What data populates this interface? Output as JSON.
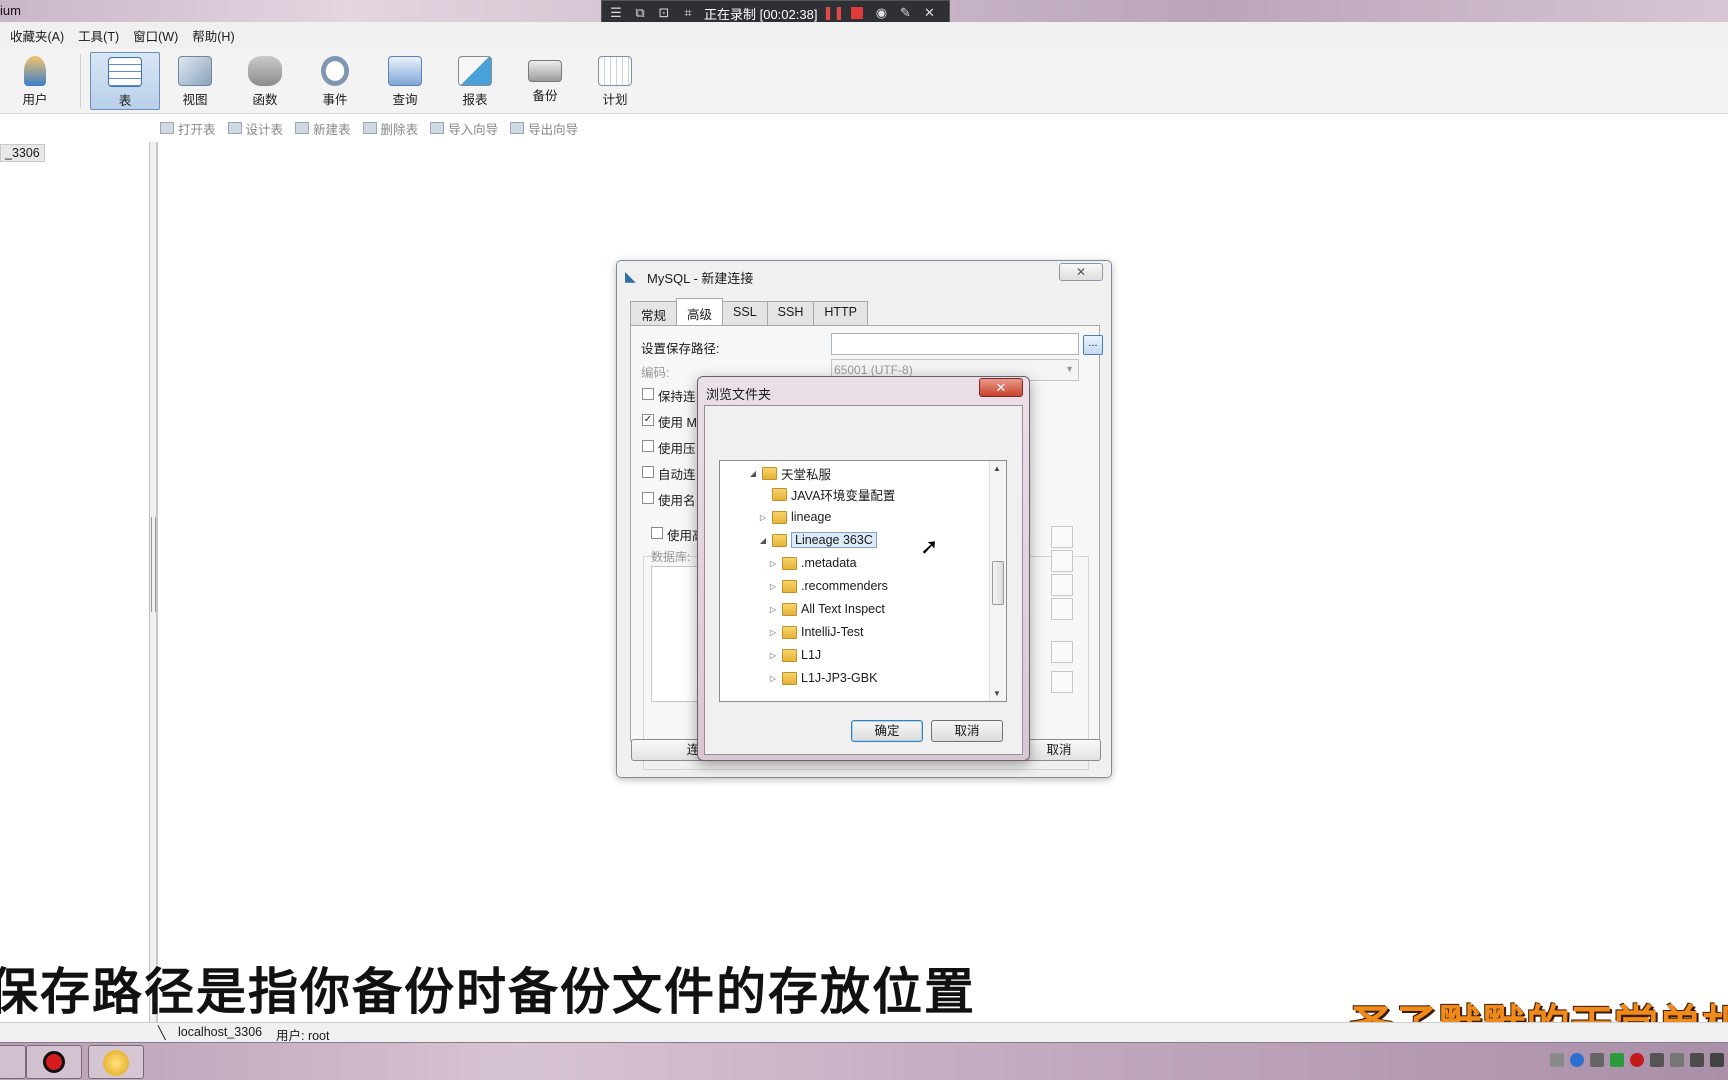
{
  "app_title": "ium",
  "recorder": {
    "status": "正在录制 [00:02:38]"
  },
  "menu": [
    "收藏夹(A)",
    "工具(T)",
    "窗口(W)",
    "帮助(H)"
  ],
  "toolbar": {
    "items": [
      {
        "label": "用户",
        "icon": "user-icon"
      },
      {
        "label": "表",
        "icon": "table-icon"
      },
      {
        "label": "视图",
        "icon": "view-icon"
      },
      {
        "label": "函数",
        "icon": "function-icon"
      },
      {
        "label": "事件",
        "icon": "event-icon"
      },
      {
        "label": "查询",
        "icon": "query-icon"
      },
      {
        "label": "报表",
        "icon": "report-icon"
      },
      {
        "label": "备份",
        "icon": "backup-icon"
      },
      {
        "label": "计划",
        "icon": "schedule-icon"
      }
    ],
    "active": "表"
  },
  "subtoolbar": [
    "打开表",
    "设计表",
    "新建表",
    "删除表",
    "导入向导",
    "导出向导"
  ],
  "left_panel": {
    "connection": "_3306"
  },
  "status_bar": {
    "connection": "localhost_3306",
    "user": "用户: root"
  },
  "mysql_dialog": {
    "title": "MySQL - 新建连接",
    "tabs": [
      "常规",
      "高级",
      "SSL",
      "SSH",
      "HTTP"
    ],
    "selected_tab": "高级",
    "save_path_label": "设置保存路径:",
    "browse_button": "...",
    "encoding_label": "编码:",
    "encoding_value": "65001 (UTF-8)",
    "checkboxes": [
      {
        "label": "保持连",
        "checked": false
      },
      {
        "label": "使用 M",
        "checked": true
      },
      {
        "label": "使用压",
        "checked": false
      },
      {
        "label": "自动连",
        "checked": false
      },
      {
        "label": "使用名",
        "checked": false
      }
    ],
    "advanced_checkbox": "使用高",
    "database_label": "数据库:",
    "connect_button": "连",
    "cancel_button": "取消"
  },
  "browse_dialog": {
    "title": "浏览文件夹",
    "tree": [
      {
        "label": "天堂私服",
        "depth": 0,
        "expander": "expanded"
      },
      {
        "label": "JAVA环境变量配置",
        "depth": 1,
        "expander": "none"
      },
      {
        "label": "lineage",
        "depth": 1,
        "expander": "collapsed"
      },
      {
        "label": "Lineage 363C",
        "depth": 1,
        "expander": "expanded",
        "selected": true
      },
      {
        "label": ".metadata",
        "depth": 2,
        "expander": "collapsed"
      },
      {
        "label": ".recommenders",
        "depth": 2,
        "expander": "collapsed"
      },
      {
        "label": "All Text Inspect",
        "depth": 2,
        "expander": "collapsed"
      },
      {
        "label": "IntelliJ-Test",
        "depth": 2,
        "expander": "collapsed"
      },
      {
        "label": "L1J",
        "depth": 2,
        "expander": "collapsed"
      },
      {
        "label": "L1J-JP3-GBK",
        "depth": 2,
        "expander": "collapsed"
      }
    ],
    "ok_button": "确定",
    "cancel_button": "取消"
  },
  "subtitle": "保存路径是指你备份时备份文件的存放位置",
  "watermark": "圣子默默的天堂单机版"
}
